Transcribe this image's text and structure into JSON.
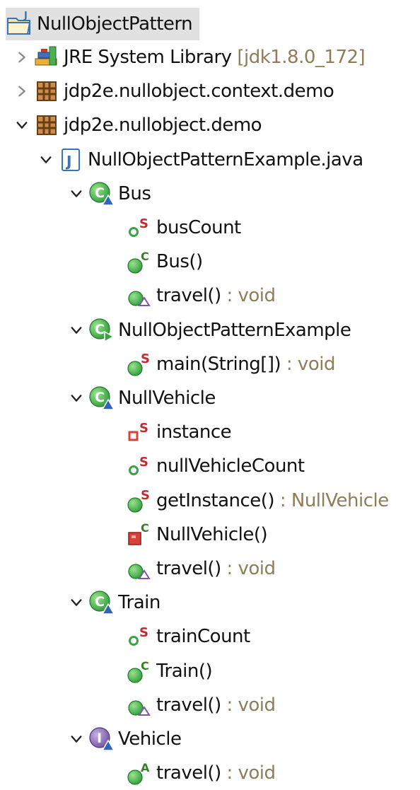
{
  "tree": {
    "root": {
      "label": "NullObjectPattern",
      "icon": "java-project-icon"
    },
    "rows": [
      {
        "label": "JRE System Library",
        "suffix": " [jdk1.8.0_172]",
        "icon": "library-icon",
        "indent": 1,
        "expanded": false
      },
      {
        "label": "jdp2e.nullobject.context.demo",
        "suffix": "",
        "icon": "package-icon",
        "indent": 1,
        "expanded": false
      },
      {
        "label": "jdp2e.nullobject.demo",
        "suffix": "",
        "icon": "package-icon",
        "indent": 1,
        "expanded": true
      },
      {
        "label": "NullObjectPatternExample.java",
        "suffix": "",
        "icon": "java-file-icon",
        "indent": 2,
        "expanded": true
      },
      {
        "label": "Bus",
        "suffix": "",
        "icon": "class-icon",
        "indent": 3,
        "expanded": true
      },
      {
        "label": "busCount",
        "suffix": "",
        "icon": "static-field-icon",
        "indent": 4,
        "expanded": null
      },
      {
        "label": "Bus()",
        "suffix": "",
        "icon": "constructor-icon",
        "indent": 4,
        "expanded": null
      },
      {
        "label": "travel()",
        "suffix": " : void",
        "icon": "override-method-icon",
        "indent": 4,
        "expanded": null
      },
      {
        "label": "NullObjectPatternExample",
        "suffix": "",
        "icon": "main-class-icon",
        "indent": 3,
        "expanded": true
      },
      {
        "label": "main(String[])",
        "suffix": " : void",
        "icon": "static-method-icon",
        "indent": 4,
        "expanded": null
      },
      {
        "label": "NullVehicle",
        "suffix": "",
        "icon": "class-icon",
        "indent": 3,
        "expanded": true
      },
      {
        "label": "instance",
        "suffix": "",
        "icon": "private-static-field-icon",
        "indent": 4,
        "expanded": null
      },
      {
        "label": "nullVehicleCount",
        "suffix": "",
        "icon": "static-field-icon",
        "indent": 4,
        "expanded": null
      },
      {
        "label": "getInstance()",
        "suffix": " : NullVehicle",
        "icon": "static-method-icon",
        "indent": 4,
        "expanded": null
      },
      {
        "label": "NullVehicle()",
        "suffix": "",
        "icon": "private-constructor-icon",
        "indent": 4,
        "expanded": null
      },
      {
        "label": "travel()",
        "suffix": " : void",
        "icon": "override-method-icon",
        "indent": 4,
        "expanded": null
      },
      {
        "label": "Train",
        "suffix": "",
        "icon": "class-icon",
        "indent": 3,
        "expanded": true
      },
      {
        "label": "trainCount",
        "suffix": "",
        "icon": "static-field-icon",
        "indent": 4,
        "expanded": null
      },
      {
        "label": "Train()",
        "suffix": "",
        "icon": "constructor-icon",
        "indent": 4,
        "expanded": null
      },
      {
        "label": "travel()",
        "suffix": " : void",
        "icon": "override-method-icon",
        "indent": 4,
        "expanded": null
      },
      {
        "label": "Vehicle",
        "suffix": "",
        "icon": "interface-icon",
        "indent": 3,
        "expanded": true
      },
      {
        "label": "travel()",
        "suffix": " : void",
        "icon": "abstract-method-icon",
        "indent": 4,
        "expanded": null
      }
    ]
  },
  "colors": {
    "selected_bg": "#e1e1e1",
    "suffix_text": "#8e7d56",
    "class_green": "#3aa345",
    "method_green": "#3aa345",
    "private_red": "#d9413a",
    "static_s_red": "#c72a2a",
    "interface_purple": "#7b5ba6",
    "overlay_blue": "#2f64b8"
  }
}
